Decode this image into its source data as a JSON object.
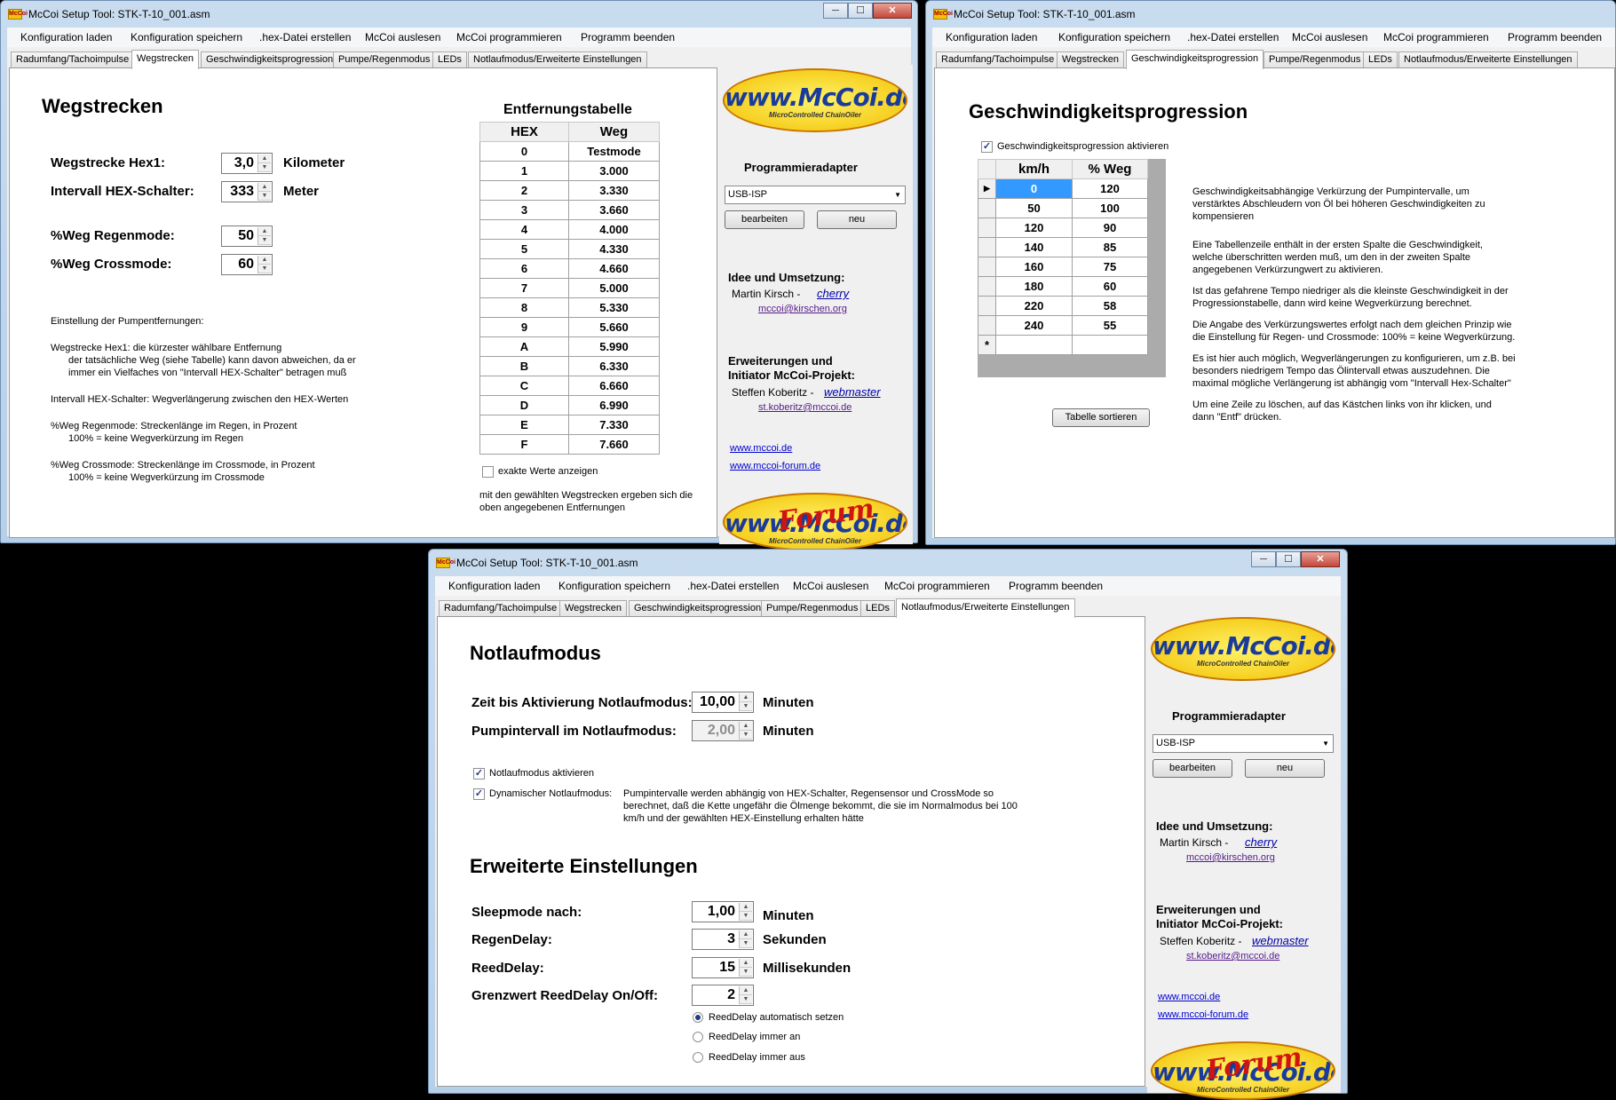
{
  "app": {
    "title": "McCoi Setup Tool: STK-T-10_001.asm",
    "icon_label": "McCoi",
    "controls": {
      "minimize": "─",
      "maximize": "☐",
      "close": "✕"
    }
  },
  "menu": [
    "Konfiguration laden",
    "Konfiguration speichern",
    ".hex-Datei erstellen",
    "McCoi auslesen",
    "McCoi programmieren",
    "Programm beenden"
  ],
  "tabs": [
    "Radumfang/Tachoimpulse",
    "Wegstrecken",
    "Geschwindigkeitsprogression",
    "Pumpe/Regenmodus",
    "LEDs",
    "Notlaufmodus/Erweiterte Einstellungen"
  ],
  "sidebar": {
    "logo_top": "www.McCoi.de",
    "logo_sub": "MicroControlled ChainOiler",
    "logo_forum": "Forum",
    "adapter_title": "Programmieradapter",
    "adapter_value": "USB-ISP",
    "btn_edit": "bearbeiten",
    "btn_new": "neu",
    "idea_title": "Idee und Umsetzung:",
    "idea_name": "Martin Kirsch -",
    "idea_nick": "cherry",
    "idea_mail": "mccoi@kirschen.org",
    "ext_title_1": "Erweiterungen und",
    "ext_title_2": "Initiator McCoi-Projekt:",
    "ext_name": "Steffen Koberitz -",
    "ext_nick": "webmaster",
    "ext_mail": "st.koberitz@mccoi.de",
    "link_1": "www.mccoi.de",
    "link_2": "www.mccoi-forum.de"
  },
  "w1": {
    "heading": "Wegstrecken",
    "row1": {
      "label": "Wegstrecke Hex1:",
      "value": "3,0",
      "unit": "Kilometer"
    },
    "row2": {
      "label": "Intervall HEX-Schalter:",
      "value": "333",
      "unit": "Meter"
    },
    "row3": {
      "label": "%Weg Regenmode:",
      "value": "50"
    },
    "row4": {
      "label": "%Weg Crossmode:",
      "value": "60"
    },
    "help": {
      "p1": "Einstellung der Pumpentfernungen:",
      "p2a": "Wegstrecke Hex1: die kürzester wählbare Entfernung",
      "p2b": "der tatsächliche Weg (siehe Tabelle) kann davon abweichen, da er",
      "p2c": "immer ein Vielfaches von \"Intervall HEX-Schalter\" betragen muß",
      "p3": "Intervall HEX-Schalter: Wegverlängerung zwischen den HEX-Werten",
      "p4a": "%Weg Regenmode: Streckenlänge im Regen, in Prozent",
      "p4b": "100% = keine Wegverkürzung im Regen",
      "p5a": "%Weg Crossmode: Streckenlänge im Crossmode, in Prozent",
      "p5b": "100% = keine Wegverkürzung im Crossmode"
    },
    "table_title": "Entfernungstabelle",
    "table_headers": [
      "HEX",
      "Weg"
    ],
    "table_rows": [
      [
        "0",
        "Testmode"
      ],
      [
        "1",
        "3.000"
      ],
      [
        "2",
        "3.330"
      ],
      [
        "3",
        "3.660"
      ],
      [
        "4",
        "4.000"
      ],
      [
        "5",
        "4.330"
      ],
      [
        "6",
        "4.660"
      ],
      [
        "7",
        "5.000"
      ],
      [
        "8",
        "5.330"
      ],
      [
        "9",
        "5.660"
      ],
      [
        "A",
        "5.990"
      ],
      [
        "B",
        "6.330"
      ],
      [
        "C",
        "6.660"
      ],
      [
        "D",
        "6.990"
      ],
      [
        "E",
        "7.330"
      ],
      [
        "F",
        "7.660"
      ]
    ],
    "chk_exact": "exakte Werte anzeigen",
    "note": "mit den gewählten Wegstrecken ergeben sich die oben angegebenen Entfernungen"
  },
  "w2": {
    "heading": "Geschwindigkeitsprogression",
    "chk_activate": "Geschwindigkeitsprogression aktivieren",
    "headers": [
      "km/h",
      "% Weg"
    ],
    "rows": [
      [
        "0",
        "120"
      ],
      [
        "50",
        "100"
      ],
      [
        "120",
        "90"
      ],
      [
        "140",
        "85"
      ],
      [
        "160",
        "75"
      ],
      [
        "180",
        "60"
      ],
      [
        "220",
        "58"
      ],
      [
        "240",
        "55"
      ]
    ],
    "new_row_marker": "*",
    "current_row_marker": "▶",
    "btn_sort": "Tabelle sortieren",
    "help": [
      "Geschwindigkeitsabhängige Verkürzung der Pumpintervalle, um verstärktes Abschleudern von Öl bei höheren Geschwindigkeiten zu kompensieren",
      "Eine Tabellenzeile enthält in der ersten Spalte die Geschwindigkeit, welche überschritten werden muß, um den in der zweiten Spalte angegebenen Verkürzungwert zu aktivieren.",
      "Ist das gefahrene Tempo niedriger als die kleinste Geschwindigkeit in der Progressionstabelle, dann wird keine Wegverkürzung berechnet.",
      "Die Angabe des Verkürzungswertes erfolgt nach dem gleichen Prinzip wie die Einstellung für Regen- und Crossmode: 100% = keine Wegverkürzung.",
      "Es ist hier auch möglich, Wegverlängerungen zu konfigurieren, um z.B. bei besonders niedrigem Tempo das Ölintervall etwas auszudehnen. Die maximal mögliche Verlängerung ist abhängig vom \"Intervall Hex-Schalter\"",
      "Um eine Zeile zu löschen, auf das Kästchen links von ihr klicken, und dann \"Entf\" drücken."
    ]
  },
  "w3": {
    "heading1": "Notlaufmodus",
    "row1": {
      "label": "Zeit bis Aktivierung Notlaufmodus:",
      "value": "10,00",
      "unit": "Minuten"
    },
    "row2": {
      "label": "Pumpintervall im Notlaufmodus:",
      "value": "2,00",
      "unit": "Minuten"
    },
    "chk1": "Notlaufmodus aktivieren",
    "chk2": "Dynamischer Notlaufmodus:",
    "chk2_desc": "Pumpintervalle werden abhängig von HEX-Schalter, Regensensor und CrossMode so berechnet, daß die Kette ungefähr die Ölmenge bekommt, die sie im Normalmodus bei 100 km/h und der gewählten HEX-Einstellung erhalten hätte",
    "heading2": "Erweiterte Einstellungen",
    "row3": {
      "label": "Sleepmode nach:",
      "value": "1,00",
      "unit": "Minuten"
    },
    "row4": {
      "label": "RegenDelay:",
      "value": "3",
      "unit": "Sekunden"
    },
    "row5": {
      "label": "ReedDelay:",
      "value": "15",
      "unit": "Millisekunden"
    },
    "row6": {
      "label": "Grenzwert ReedDelay On/Off:",
      "value": "2"
    },
    "radios": [
      "ReedDelay automatisch setzen",
      "ReedDelay immer an",
      "ReedDelay immer aus"
    ]
  }
}
